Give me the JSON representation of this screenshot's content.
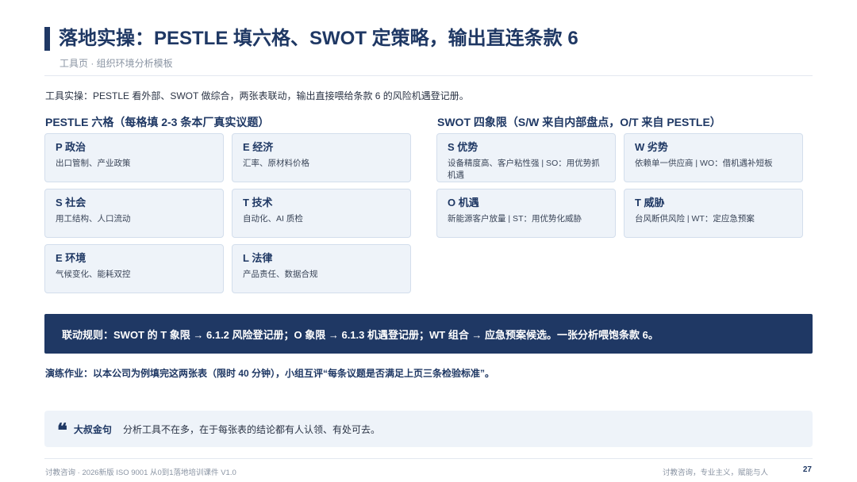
{
  "header": {
    "title": "落地实操：PESTLE 填六格、SWOT 定策略，输出直连条款 6",
    "subtitle": "工具页 · 组织环境分析模板"
  },
  "intro": "工具实操：PESTLE 看外部、SWOT 做综合，两张表联动，输出直接喂给条款 6 的风险机遇登记册。",
  "pestle": {
    "title": "PESTLE 六格（每格填 2-3 条本厂真实议题）",
    "cards": [
      {
        "head": "P 政治",
        "body": "出口管制、产业政策"
      },
      {
        "head": "E 经济",
        "body": "汇率、原材料价格"
      },
      {
        "head": "S 社会",
        "body": "用工结构、人口流动"
      },
      {
        "head": "T 技术",
        "body": "自动化、AI 质检"
      },
      {
        "head": "E 环境",
        "body": "气候变化、能耗双控"
      },
      {
        "head": "L 法律",
        "body": "产品责任、数据合规"
      }
    ]
  },
  "swot": {
    "title": "SWOT 四象限（S/W 来自内部盘点，O/T 来自 PESTLE）",
    "cards": [
      {
        "head": "S 优势",
        "body": "设备精度高、客户粘性强 | SO：用优势抓机遇"
      },
      {
        "head": "W 劣势",
        "body": "依赖单一供应商 | WO：借机遇补短板"
      },
      {
        "head": "O 机遇",
        "body": "新能源客户放量 | ST：用优势化威胁"
      },
      {
        "head": "T 威胁",
        "body": "台风断供风险 | WT：定应急预案"
      }
    ]
  },
  "rule": "联动规则：SWOT 的 T 象限 → 6.1.2 风险登记册；O 象限 → 6.1.3 机遇登记册；WT 组合 → 应急预案候选。一张分析喂饱条款 6。",
  "homework": "演练作业：以本公司为例填完这两张表（限时 40 分钟），小组互评“每条议题是否满足上页三条检验标准”。",
  "quote": {
    "icon": "quote-icon",
    "mark": "❝",
    "label": "大叔金句",
    "text": "分析工具不在多，在于每张表的结论都有人认领、有处可去。"
  },
  "footer": {
    "left": "讨教咨询 · 2026新版 ISO 9001 从0到1落地培训课件 V1.0",
    "right": "讨教咨询，专业主义，赋能与人",
    "page": "27"
  },
  "colors": {
    "brand": "#1f3864",
    "card_bg": "#eef3f9",
    "card_border": "#d3deec"
  }
}
